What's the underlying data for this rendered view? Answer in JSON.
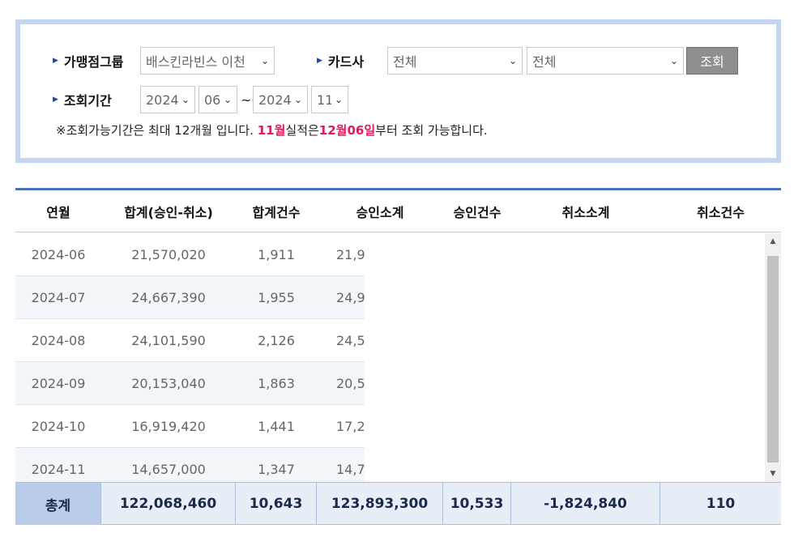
{
  "search": {
    "group_label": "가맹점그룹",
    "group_value": "배스킨라빈스 이천",
    "card_label": "카드사",
    "card_value1": "전체",
    "card_value2": "전체",
    "search_button": "조회",
    "period_label": "조회기간",
    "from_year": "2024",
    "from_month": "06",
    "tilde": "~",
    "to_year": "2024",
    "to_month": "11",
    "notice_prefix": "※조회가능기간은 최대 12개월 입니다. ",
    "notice_month": "11월",
    "notice_mid": "실적은",
    "notice_date": "12월06일",
    "notice_suffix": "부터 조회 가능합니다."
  },
  "table": {
    "headers": [
      "연월",
      "합계(승인-취소)",
      "합계건수",
      "승인소계",
      "승인건수",
      "취소소계",
      "취소건수"
    ],
    "rows": [
      {
        "month": "2024-06",
        "total": "21,570,020",
        "count": "1,911",
        "approval": "21,9"
      },
      {
        "month": "2024-07",
        "total": "24,667,390",
        "count": "1,955",
        "approval": "24,9"
      },
      {
        "month": "2024-08",
        "total": "24,101,590",
        "count": "2,126",
        "approval": "24,5"
      },
      {
        "month": "2024-09",
        "total": "20,153,040",
        "count": "1,863",
        "approval": "20,5"
      },
      {
        "month": "2024-10",
        "total": "16,919,420",
        "count": "1,441",
        "approval": "17,2"
      },
      {
        "month": "2024-11",
        "total": "14,657,000",
        "count": "1,347",
        "approval": "14,7"
      }
    ],
    "footer": {
      "label": "총계",
      "total": "122,068,460",
      "count": "10,643",
      "approval_sum": "123,893,300",
      "approval_count": "10,533",
      "cancel_sum": "-1,824,840",
      "cancel_count": "110"
    }
  },
  "icons": {
    "arrow": "triangle-right-icon",
    "dropdown": "chevron-down-icon",
    "scroll_up": "scroll-up-icon",
    "scroll_down": "scroll-down-icon"
  },
  "colors": {
    "accent_blue": "#4773b8",
    "panel_border": "#c4d6ee",
    "highlight": "#e5195f",
    "footer_bg": "#e8eef8",
    "footer_label_bg": "#b9cdea",
    "button_gray": "#8f8f8f"
  }
}
